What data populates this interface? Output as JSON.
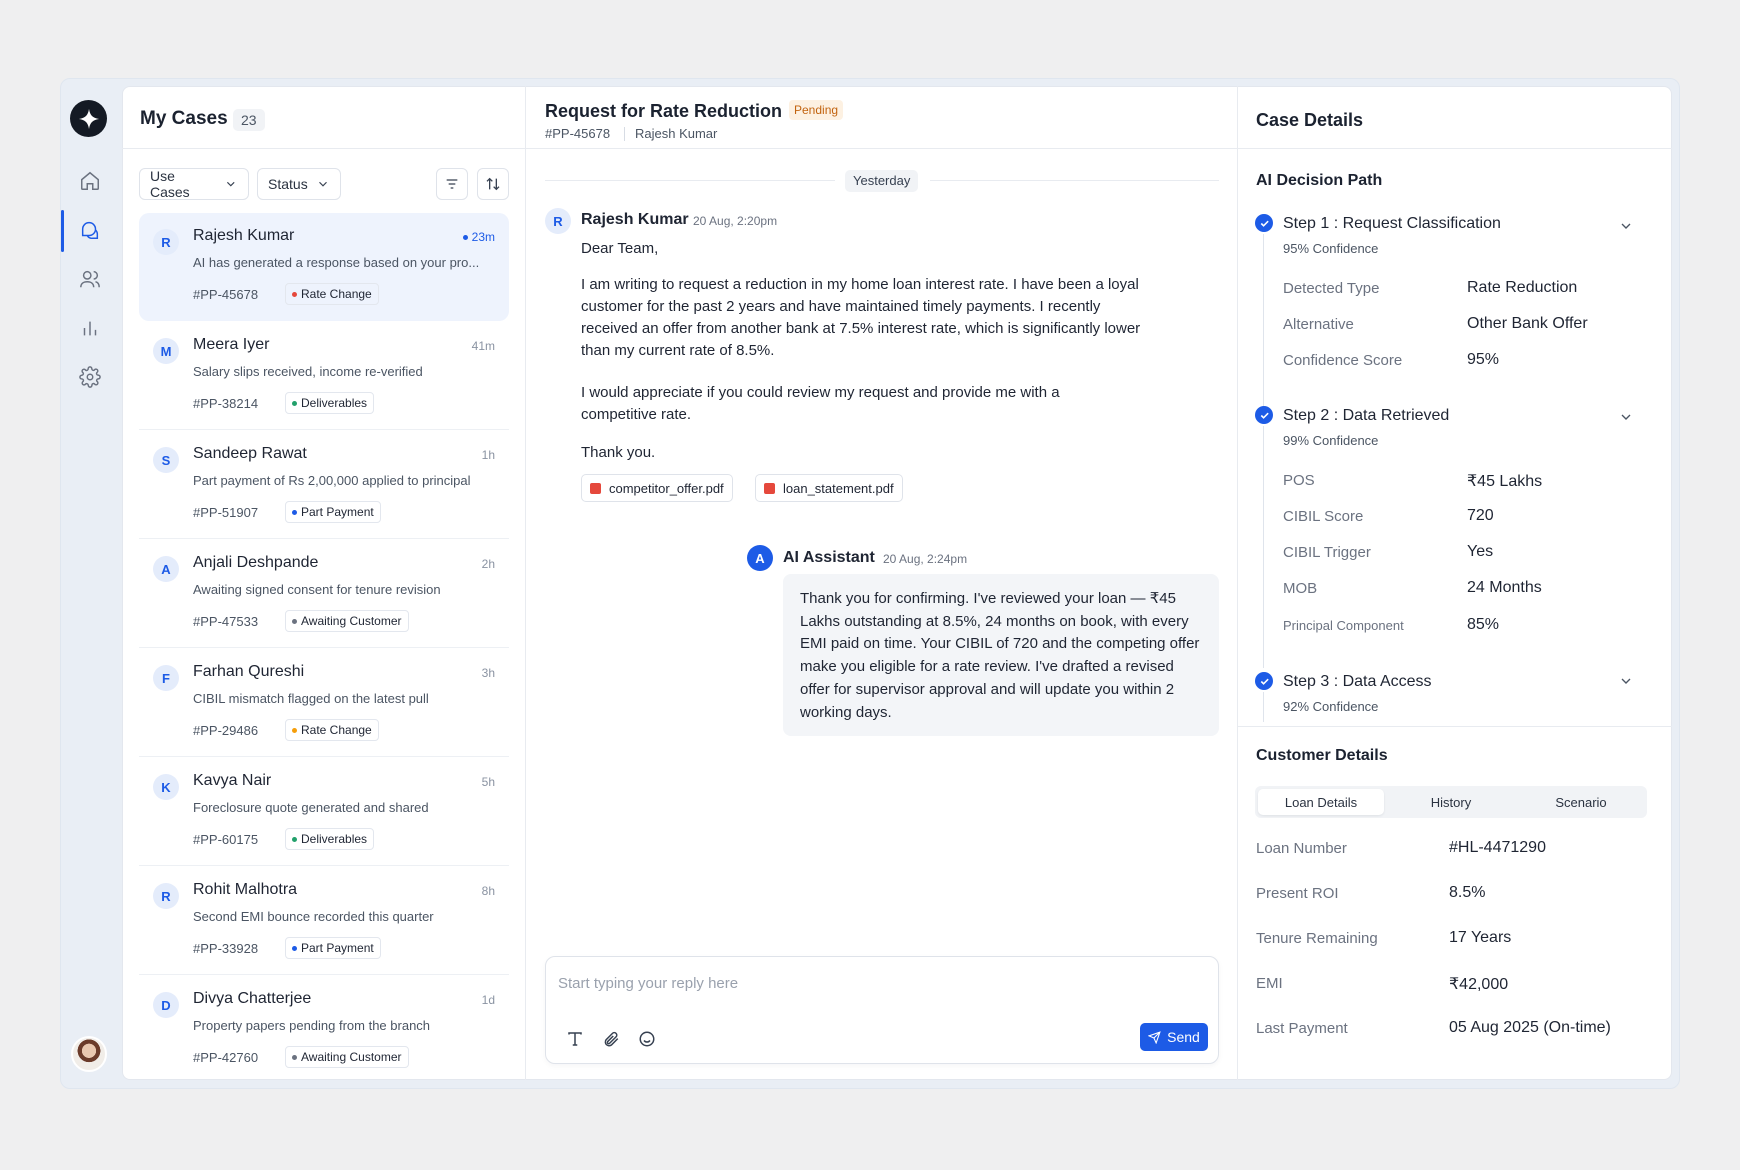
{
  "nav": {
    "items": [
      "home",
      "cases",
      "users",
      "analytics",
      "settings"
    ]
  },
  "cases": {
    "title": "My Cases",
    "count": "23",
    "filters": {
      "use_cases": "Use Cases",
      "status": "Status"
    },
    "items": [
      {
        "initial": "R",
        "name": "Rajesh Kumar",
        "time": "23m",
        "desc": "AI has generated a response based on your pro...",
        "id": "#PP-45678",
        "tag": "Rate Change",
        "tag_color": "#e5483c"
      },
      {
        "initial": "M",
        "name": "Meera Iyer",
        "time": "41m",
        "desc": "Salary slips received, income re-verified",
        "id": "#PP-38214",
        "tag": "Deliverables",
        "tag_color": "#22a06b"
      },
      {
        "initial": "S",
        "name": "Sandeep Rawat",
        "time": "1h",
        "desc": "Part payment of Rs 2,00,000 applied to principal",
        "id": "#PP-51907",
        "tag": "Part Payment",
        "tag_color": "#1d5be6"
      },
      {
        "initial": "A",
        "name": "Anjali Deshpande",
        "time": "2h",
        "desc": "Awaiting signed consent for tenure revision",
        "id": "#PP-47533",
        "tag": "Awaiting Customer",
        "tag_color": "#6b7280"
      },
      {
        "initial": "F",
        "name": "Farhan Qureshi",
        "time": "3h",
        "desc": "CIBIL mismatch flagged on the latest pull",
        "id": "#PP-29486",
        "tag": "Rate Change",
        "tag_color": "#f59e0b"
      },
      {
        "initial": "K",
        "name": "Kavya Nair",
        "time": "5h",
        "desc": "Foreclosure quote generated and shared",
        "id": "#PP-60175",
        "tag": "Deliverables",
        "tag_color": "#22a06b"
      },
      {
        "initial": "R",
        "name": "Rohit Malhotra",
        "time": "8h",
        "desc": "Second EMI bounce recorded this quarter",
        "id": "#PP-33928",
        "tag": "Part Payment",
        "tag_color": "#1d5be6"
      },
      {
        "initial": "D",
        "name": "Divya Chatterjee",
        "time": "1d",
        "desc": "Property papers pending from the branch",
        "id": "#PP-42760",
        "tag": "Awaiting Customer",
        "tag_color": "#6b7280"
      }
    ]
  },
  "conversation": {
    "title": "Request for Rate Reduction",
    "status": "Pending",
    "case_id": "#PP-45678",
    "customer": "Rajesh Kumar",
    "day_label": "Yesterday",
    "customer_msg": {
      "initial": "R",
      "sender": "Rajesh Kumar",
      "time": "20 Aug, 2:20pm",
      "greeting": "Dear Team,",
      "p1": "I am writing to request a reduction in my home loan interest rate. I have been a loyal customer for the past 2 years and have maintained timely payments. I recently received an offer from another bank at 7.5% interest rate, which is significantly lower than my current rate of 8.5%.",
      "p2": "I would appreciate if you could review my request and provide me with a competitive rate.",
      "closing": "Thank you.",
      "attachments": [
        "competitor_offer.pdf",
        "loan_statement.pdf"
      ]
    },
    "ai_msg": {
      "initial": "A",
      "sender": "AI Assistant",
      "time": "20 Aug, 2:24pm",
      "text": "Thank you for confirming. I've reviewed your loan — ₹45 Lakhs outstanding at 8.5%, 24 months on book, with every EMI paid on time. Your CIBIL of 720 and the competing offer make you eligible for a rate review. I've drafted a revised offer for supervisor approval and will update you within 2 working days."
    },
    "composer": {
      "placeholder": "Start typing your reply here",
      "send_label": "Send"
    }
  },
  "details": {
    "title": "Case Details",
    "decision_title": "AI Decision Path",
    "steps": [
      {
        "title": "Step 1 : Request Classification",
        "confidence": "95% Confidence",
        "rows": [
          {
            "k": "Detected Type",
            "v": "Rate Reduction"
          },
          {
            "k": "Alternative",
            "v": "Other Bank Offer"
          },
          {
            "k": "Confidence Score",
            "v": "95%"
          }
        ]
      },
      {
        "title": "Step 2 : Data Retrieved",
        "confidence": "99% Confidence",
        "rows": [
          {
            "k": "POS",
            "v": "₹45 Lakhs"
          },
          {
            "k": "CIBIL Score",
            "v": "720"
          },
          {
            "k": "CIBIL Trigger",
            "v": "Yes"
          },
          {
            "k": "MOB",
            "v": "24 Months"
          },
          {
            "k": "Principal Component",
            "v": "85%"
          }
        ]
      },
      {
        "title": "Step 3 : Data Access",
        "confidence": "92% Confidence",
        "rows": []
      }
    ],
    "customer_title": "Customer Details",
    "tabs": [
      "Loan Details",
      "History",
      "Scenario"
    ],
    "customer_rows": [
      {
        "k": "Loan Number",
        "v": "#HL-4471290"
      },
      {
        "k": "Present ROI",
        "v": "8.5%"
      },
      {
        "k": "Tenure Remaining",
        "v": "17 Years"
      },
      {
        "k": "EMI",
        "v": "₹42,000"
      },
      {
        "k": "Last Payment",
        "v": "05 Aug 2025 (On-time)"
      }
    ]
  }
}
